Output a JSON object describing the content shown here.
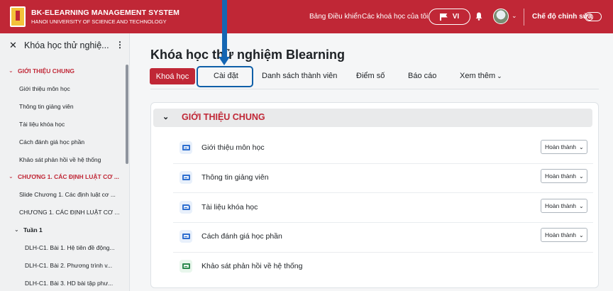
{
  "navbar": {
    "brand_title": "BK-ELEARNING MANAGEMENT SYSTEM",
    "brand_subtitle": "HANOI UNIVERSITY OF SCIENCE AND TECHNOLOGY",
    "link_dashboard": "Bảng Điều khiển",
    "link_my_courses": "Các khoá học của tôi",
    "language": "VI",
    "edit_mode_label": "Chế độ chỉnh sửa"
  },
  "sidebar": {
    "title": "Khóa học thử nghiệ...",
    "items": [
      {
        "type": "section",
        "label": "GIỚI THIỆU CHUNG"
      },
      {
        "type": "item",
        "label": "Giới thiệu môn học"
      },
      {
        "type": "item",
        "label": "Thông tin giảng viên"
      },
      {
        "type": "item",
        "label": "Tài liệu khóa học"
      },
      {
        "type": "item",
        "label": "Cách đánh giá học phần"
      },
      {
        "type": "item",
        "label": "Khảo sát phản hồi về hệ thống"
      },
      {
        "type": "section",
        "label": "CHƯƠNG 1. CÁC ĐỊNH LUẬT CƠ ..."
      },
      {
        "type": "item",
        "label": "Slide Chương 1. Các định luật cơ ..."
      },
      {
        "type": "item",
        "label": "CHƯƠNG 1. CÁC ĐỊNH LUẬT CƠ ..."
      },
      {
        "type": "subsection",
        "label": "Tuần 1"
      },
      {
        "type": "subitem",
        "label": "DLH-C1. Bài 1. Hệ tiên đề động..."
      },
      {
        "type": "subitem",
        "label": "DLH-C1. Bài 2. Phương trình v..."
      },
      {
        "type": "subitem",
        "label": "DLH-C1. Bài 3. HD bài tập phư..."
      }
    ]
  },
  "main": {
    "course_title": "Khóa học thử nghiệm Blearning",
    "tabs": [
      "Khoá học",
      "Cài đặt",
      "Danh sách thành viên",
      "Điểm số",
      "Báo cáo",
      "Xem thêm"
    ],
    "section_title": "GIỚI THIỆU CHUNG",
    "activities": [
      {
        "name": "Giới thiệu môn học",
        "icon": "page-icon",
        "status": "Hoàn thành"
      },
      {
        "name": "Thông tin giảng viên",
        "icon": "page-icon",
        "status": "Hoàn thành"
      },
      {
        "name": "Tài liệu khóa học",
        "icon": "folder-icon",
        "status": "Hoàn thành"
      },
      {
        "name": "Cách đánh giá học phần",
        "icon": "page-icon",
        "status": "Hoàn thành"
      },
      {
        "name": "Khảo sát phản hồi về hệ thống",
        "icon": "feedback-icon",
        "status": ""
      }
    ]
  },
  "colors": {
    "brand": "#c02736",
    "highlight": "#0f5fa8",
    "arrow": "#1566b3"
  }
}
